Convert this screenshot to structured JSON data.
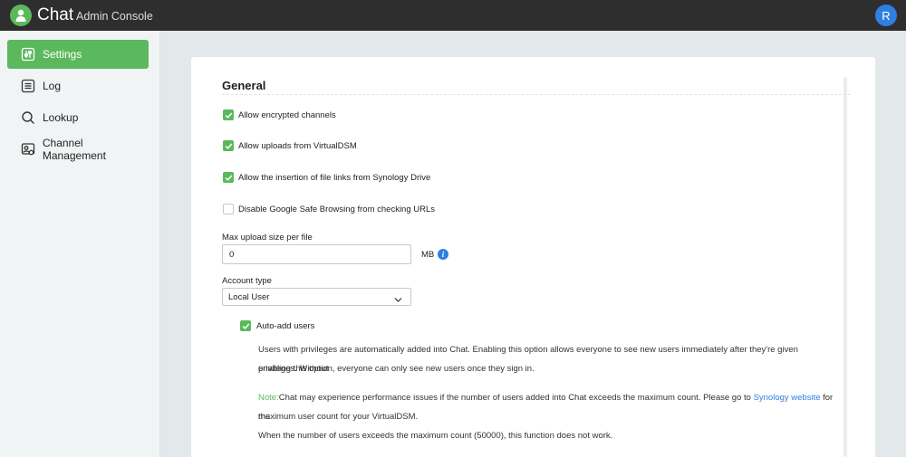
{
  "header": {
    "app_name": "Chat",
    "app_subtitle": "Admin Console",
    "avatar_letter": "R"
  },
  "sidebar": {
    "items": [
      {
        "label": "Settings",
        "icon": "settings-sliders-icon",
        "active": true
      },
      {
        "label": "Log",
        "icon": "log-list-icon",
        "active": false
      },
      {
        "label": "Lookup",
        "icon": "lookup-search-icon",
        "active": false
      },
      {
        "label": "Channel Management",
        "icon": "channel-management-icon",
        "active": false
      }
    ]
  },
  "general": {
    "title": "General",
    "checkboxes": [
      {
        "label": "Allow encrypted channels",
        "checked": true
      },
      {
        "label": "Allow uploads from VirtualDSM",
        "checked": true
      },
      {
        "label": "Allow the insertion of file links from Synology Drive",
        "checked": true
      },
      {
        "label": "Disable Google Safe Browsing from checking URLs",
        "checked": false
      }
    ],
    "max_upload": {
      "label": "Max upload size per file",
      "value": "0",
      "unit": "MB",
      "info_icon": "i"
    },
    "account_type": {
      "label": "Account type",
      "selected": "Local User"
    },
    "auto_add": {
      "label": "Auto-add users",
      "checked": true,
      "description_line1": "Users with privileges are automatically added into Chat. Enabling this option allows everyone to see new users immediately after they're given privileges. Without",
      "description_line2": "enabling this option, everyone can only see new users once they sign in.",
      "note_prefix": "Note:",
      "note_text": "Chat may experience performance issues if the number of users added into Chat exceeds the maximum count. Please go to ",
      "note_link": "Synology website",
      "note_after_link": " for the",
      "note_line2": "maximum user count for your VirtualDSM.",
      "note_line3": "When the number of users exceeds the maximum count (50000), this function does not work."
    }
  },
  "colors": {
    "accent_green": "#5cb85c",
    "link_blue": "#2f7fe0",
    "topbar": "#2e2e2e"
  }
}
